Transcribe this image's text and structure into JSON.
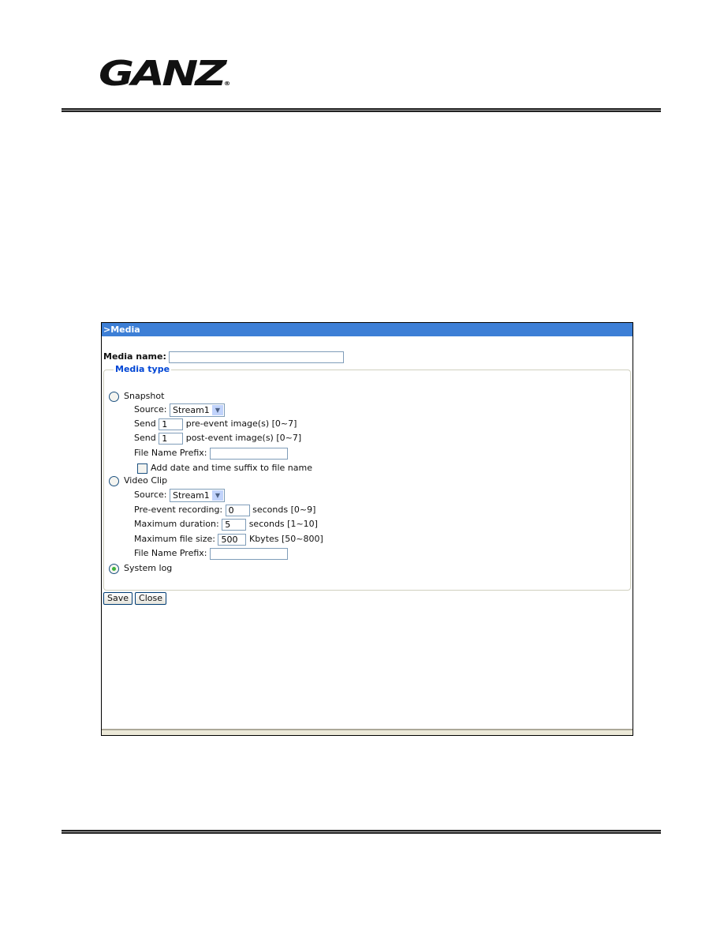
{
  "logo": {
    "text": "GANZ",
    "registered": "®"
  },
  "dialog": {
    "title": ">Media",
    "media_name_label": "Media name:",
    "media_name_value": "",
    "media_type_legend": "Media type",
    "snapshot": {
      "label": "Snapshot",
      "selected": false,
      "source_label": "Source:",
      "source_value": "Stream1",
      "send_label": "Send",
      "pre_value": "1",
      "pre_text": "pre-event image(s) [0~7]",
      "post_value": "1",
      "post_text": "post-event image(s) [0~7]",
      "prefix_label": "File Name Prefix:",
      "prefix_value": "",
      "suffix_label": "Add date and time suffix to file name",
      "suffix_checked": false
    },
    "video_clip": {
      "label": "Video Clip",
      "selected": false,
      "source_label": "Source:",
      "source_value": "Stream1",
      "pre_label": "Pre-event recording:",
      "pre_value": "0",
      "pre_text": "seconds [0~9]",
      "duration_label": "Maximum duration:",
      "duration_value": "5",
      "duration_text": "seconds [1~10]",
      "size_label": "Maximum file size:",
      "size_value": "500",
      "size_text": "Kbytes [50~800]",
      "prefix_label": "File Name Prefix:",
      "prefix_value": ""
    },
    "system_log": {
      "label": "System log",
      "selected": true
    },
    "save_label": "Save",
    "close_label": "Close"
  },
  "colors": {
    "title_bar": "#3d7fd6",
    "legend": "#0046d5"
  }
}
